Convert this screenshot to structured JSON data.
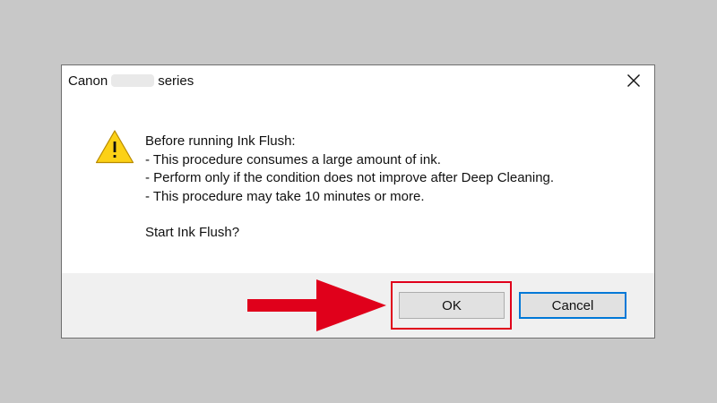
{
  "dialog": {
    "title_prefix": "Canon",
    "title_suffix": "series",
    "close_glyph": "×",
    "icon": "warning-icon",
    "message": {
      "line1": "Before running Ink Flush:",
      "line2": "- This procedure consumes a large amount of ink.",
      "line3": "- Perform only if the condition does not improve after Deep Cleaning.",
      "line4": "- This procedure may take 10 minutes or more.",
      "line5": "Start Ink Flush?"
    },
    "buttons": {
      "ok_label": "OK",
      "cancel_label": "Cancel"
    }
  },
  "annotation": {
    "highlight_color": "#e0001b",
    "arrow_color": "#e0001b",
    "highlighted_element": "ok-button"
  },
  "colors": {
    "background": "#c8c8c8",
    "dialog_body": "#ffffff",
    "footer": "#f0f0f0",
    "button_face": "#e1e1e1",
    "focus_border": "#0078d7",
    "warning_yellow": "#fcd116"
  }
}
